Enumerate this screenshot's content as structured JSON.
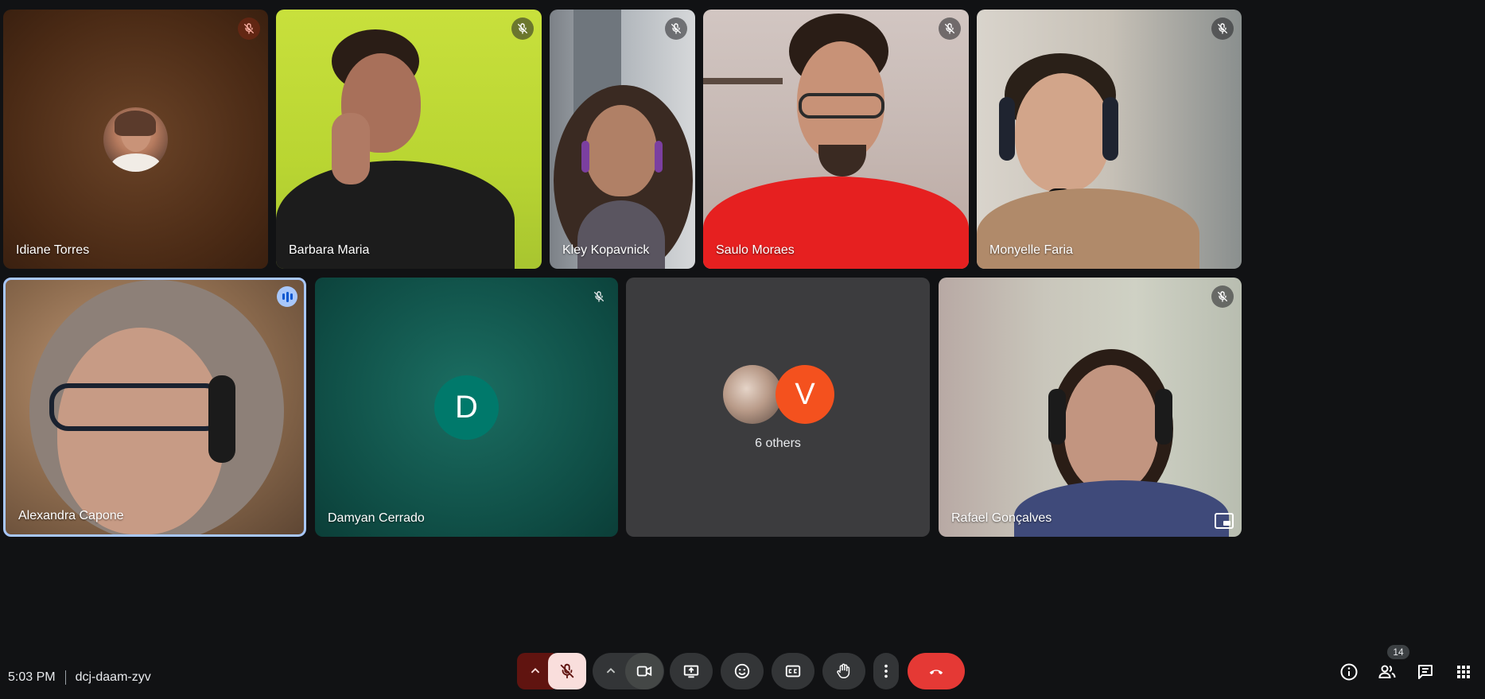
{
  "participants": [
    {
      "name": "Idiane Torres",
      "muted": true
    },
    {
      "name": "Barbara Maria",
      "muted": true
    },
    {
      "name": "Kley Kopavnick",
      "muted": true
    },
    {
      "name": "Saulo Moraes",
      "muted": true
    },
    {
      "name": "Monyelle Faria",
      "muted": true
    },
    {
      "name": "Alexandra Capone",
      "muted": false,
      "speaking": true
    },
    {
      "name": "Damyan Cerrado",
      "muted": true,
      "avatar_letter": "D"
    },
    {
      "name": "Rafael Gonçalves",
      "muted": true
    }
  ],
  "others": {
    "label": "6 others",
    "avatar_letter": "V"
  },
  "meeting": {
    "time": "5:03 PM",
    "code": "dcj-daam-zyv"
  },
  "people_count": "14",
  "colors": {
    "background": "#111214",
    "end_call": "#e53935",
    "mic_off_bg": "#f9dedc",
    "mic_arrow_bg": "#601410",
    "damyan_avatar": "#00796b",
    "others_avatar": "#f4511e",
    "speaking_ring": "#a8c7fa"
  },
  "controls": [
    {
      "name": "mic-options",
      "icon": "chevron-up-icon"
    },
    {
      "name": "mic-toggle",
      "icon": "mic-off-icon"
    },
    {
      "name": "camera-options",
      "icon": "chevron-up-icon"
    },
    {
      "name": "camera-toggle",
      "icon": "camera-icon"
    },
    {
      "name": "present-now",
      "icon": "present-icon"
    },
    {
      "name": "reactions",
      "icon": "emoji-icon"
    },
    {
      "name": "captions",
      "icon": "captions-icon"
    },
    {
      "name": "raise-hand",
      "icon": "hand-icon"
    },
    {
      "name": "more-options",
      "icon": "more-vert-icon"
    },
    {
      "name": "leave-call",
      "icon": "end-call-icon"
    }
  ],
  "right_controls": [
    {
      "name": "meeting-details",
      "icon": "info-icon"
    },
    {
      "name": "people",
      "icon": "people-icon"
    },
    {
      "name": "chat",
      "icon": "chat-icon"
    },
    {
      "name": "activities",
      "icon": "apps-grid-icon"
    }
  ]
}
